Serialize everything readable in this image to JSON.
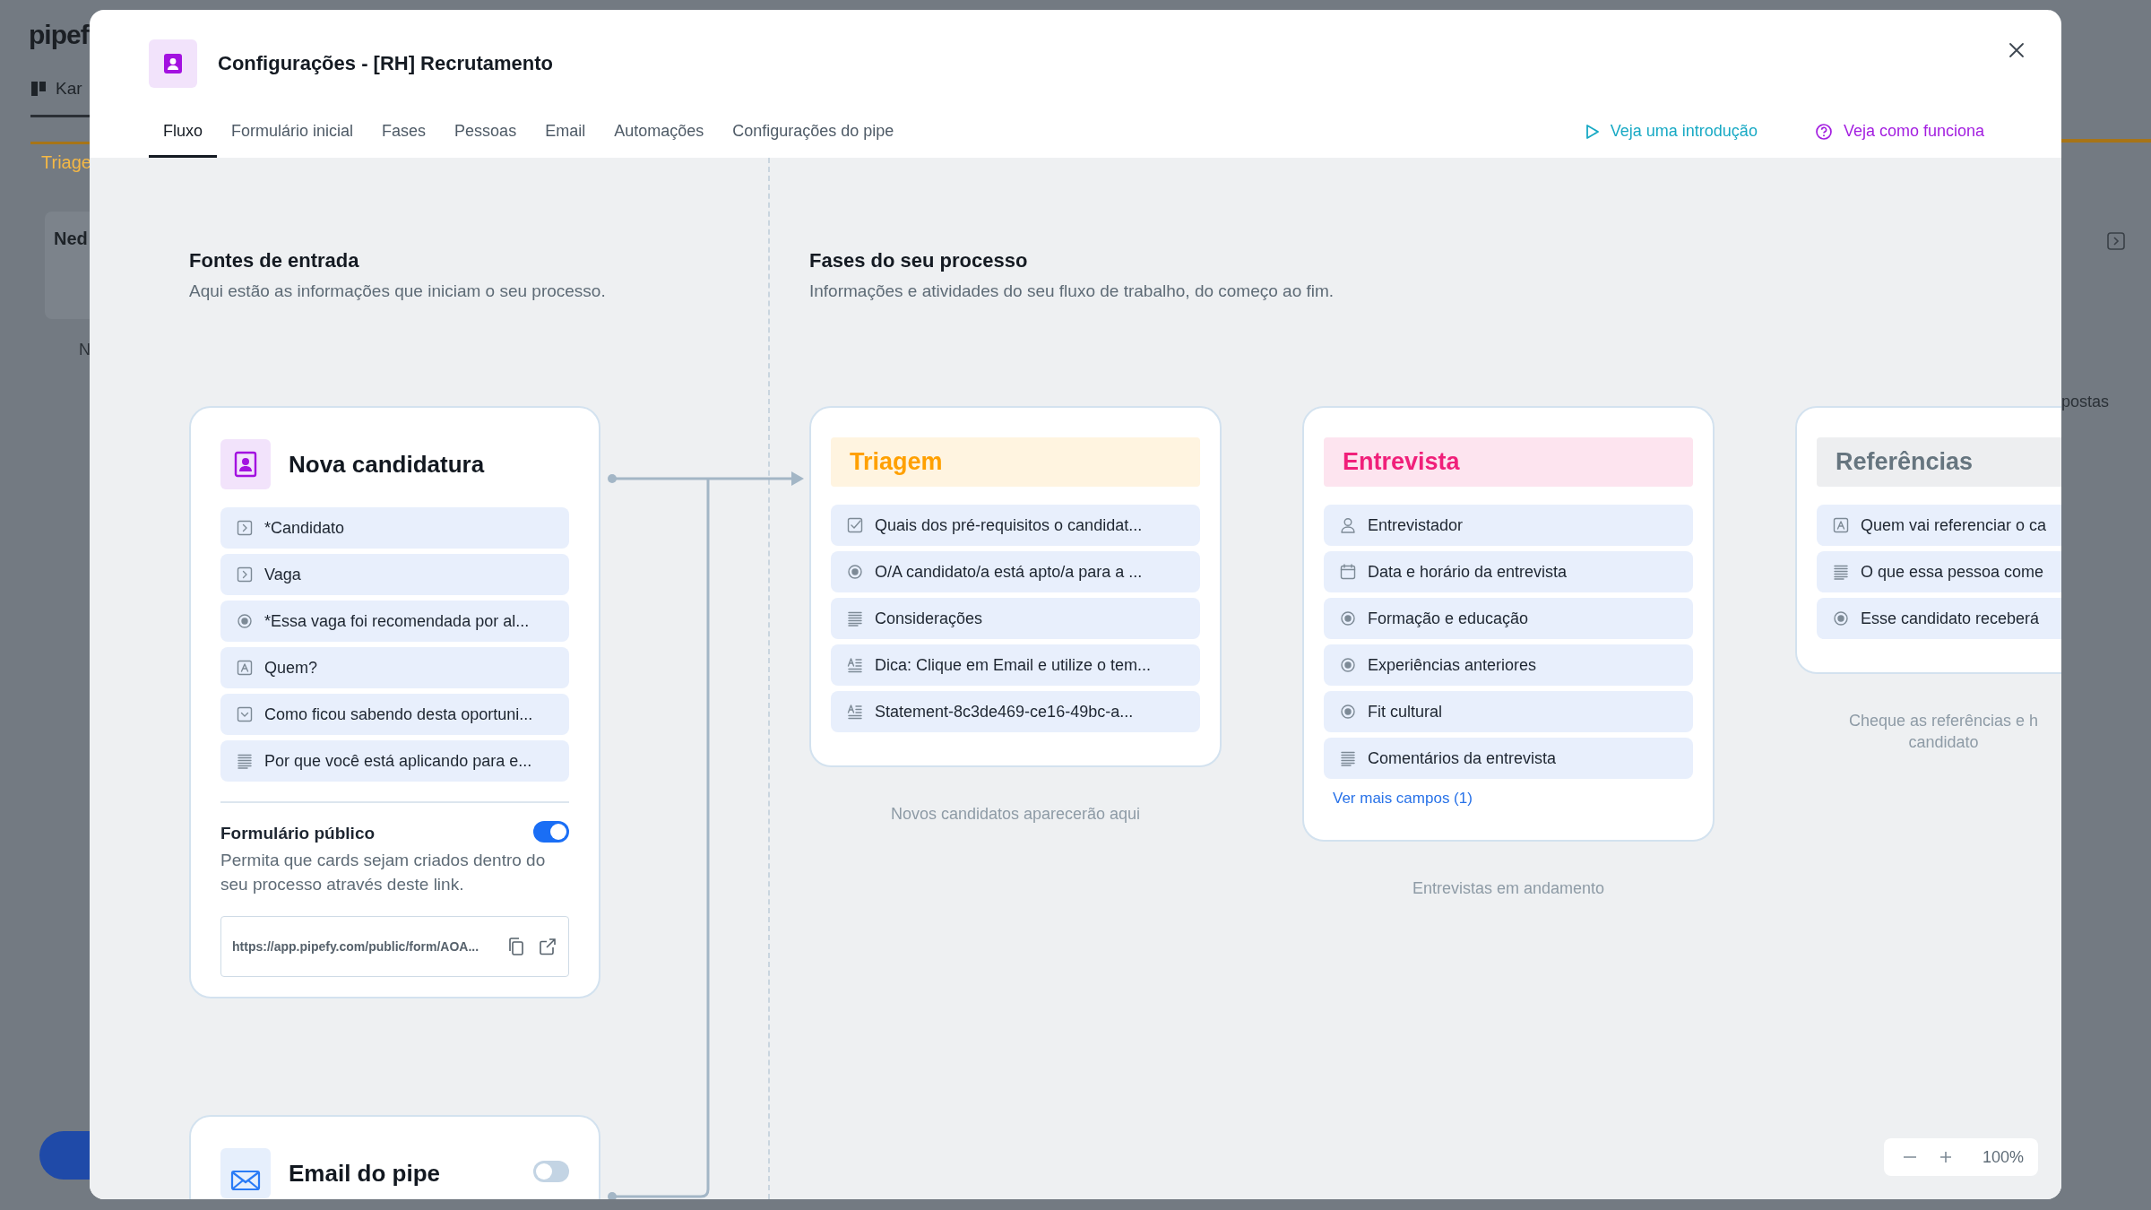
{
  "background": {
    "logo": "pipef",
    "view_tab": "Kar",
    "phase_label": "Triage",
    "card_title": "Ned",
    "card_text": "N",
    "side_text": "postas"
  },
  "modal": {
    "title": "Configurações - [RH] Recrutamento"
  },
  "tabs": [
    {
      "label": "Fluxo",
      "selected": true
    },
    {
      "label": "Formulário inicial",
      "selected": false
    },
    {
      "label": "Fases",
      "selected": false
    },
    {
      "label": "Pessoas",
      "selected": false
    },
    {
      "label": "Email",
      "selected": false
    },
    {
      "label": "Automações",
      "selected": false
    },
    {
      "label": "Configurações do pipe",
      "selected": false
    }
  ],
  "help_links": [
    {
      "kind": "video",
      "label": "Veja uma introdução"
    },
    {
      "kind": "help",
      "label": "Veja como funciona"
    }
  ],
  "sources_section": {
    "title": "Fontes de entrada",
    "subtitle": "Aqui estão as informações que iniciam o seu processo."
  },
  "source_cards": [
    {
      "kind": "form",
      "title": "Nova candidatura",
      "fields": [
        {
          "kind": "connection",
          "label": "*Candidato"
        },
        {
          "kind": "connection",
          "label": "Vaga"
        },
        {
          "kind": "radio",
          "label": "*Essa vaga foi recomendada por al..."
        },
        {
          "kind": "short_text",
          "label": "Quem?"
        },
        {
          "kind": "select",
          "label": "Como ficou sabendo desta oportuni..."
        },
        {
          "kind": "long_text",
          "label": "Por que você está aplicando para e..."
        }
      ],
      "public_form": {
        "title": "Formulário público",
        "on": true,
        "description": "Permita que cards sejam criados dentro do seu processo através deste link.",
        "url": "https://app.pipefy.com/public/form/AOA..."
      }
    },
    {
      "kind": "email",
      "title": "Email do pipe",
      "on": false
    }
  ],
  "phases_section": {
    "title": "Fases do seu processo",
    "subtitle": "Informações e atividades do seu fluxo de trabalho, do começo ao fim."
  },
  "phases": [
    {
      "name": "Triagem",
      "color": "#ffa000",
      "fields": [
        {
          "kind": "checklist",
          "label": "Quais dos pré-requisitos o candidat..."
        },
        {
          "kind": "radio",
          "label": "O/A candidato/a está apto/a para a ..."
        },
        {
          "kind": "long_text",
          "label": "Considerações"
        },
        {
          "kind": "statement",
          "label": "Dica: Clique em Email e utilize o tem..."
        },
        {
          "kind": "statement",
          "label": "Statement-8c3de469-ce16-49bc-a..."
        }
      ],
      "caption_lines": [
        "Novos candidatos aparecerão aqui"
      ]
    },
    {
      "name": "Entrevista",
      "color": "#f0207a",
      "fields": [
        {
          "kind": "assignee",
          "label": "Entrevistador"
        },
        {
          "kind": "date",
          "label": "Data e horário da entrevista"
        },
        {
          "kind": "radio",
          "label": "Formação e educação"
        },
        {
          "kind": "radio",
          "label": "Experiências anteriores"
        },
        {
          "kind": "radio",
          "label": "Fit cultural"
        },
        {
          "kind": "long_text",
          "label": "Comentários da entrevista"
        }
      ],
      "more_link": "Ver mais campos (1)",
      "caption_lines": [
        "Entrevistas em andamento"
      ]
    },
    {
      "name": "Referências",
      "color": "#66757f",
      "fields": [
        {
          "kind": "short_text",
          "label": "Quem vai referenciar o ca"
        },
        {
          "kind": "long_text",
          "label": "O que essa pessoa come"
        },
        {
          "kind": "radio",
          "label": "Esse candidato receberá"
        }
      ],
      "caption_lines": [
        "Cheque as referências e h",
        "candidato"
      ]
    }
  ],
  "zoom": {
    "level_text": "100%"
  }
}
